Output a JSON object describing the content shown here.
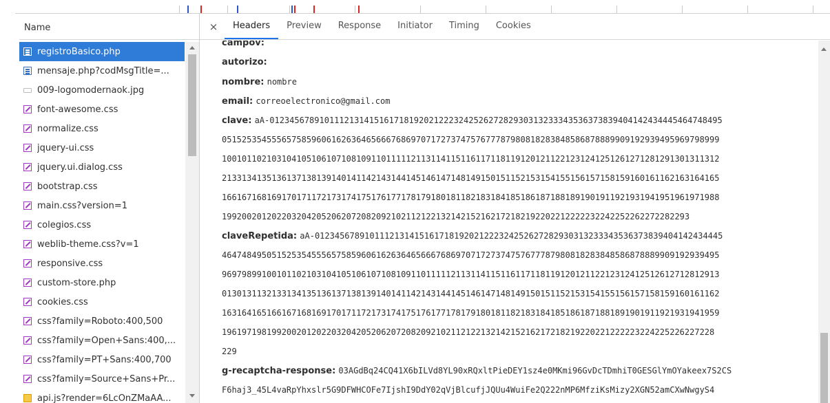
{
  "name_panel": {
    "header": "Name",
    "items": [
      {
        "label": "registroBasico.php",
        "icon": "document-icon",
        "selected": true
      },
      {
        "label": "mensaje.php?codMsgTitle=...",
        "icon": "document-icon"
      },
      {
        "label": "009-logomodernaok.jpg",
        "icon": "image-icon"
      },
      {
        "label": "font-awesome.css",
        "icon": "stylesheet-icon"
      },
      {
        "label": "normalize.css",
        "icon": "stylesheet-icon"
      },
      {
        "label": "jquery-ui.css",
        "icon": "stylesheet-icon"
      },
      {
        "label": "jquery.ui.dialog.css",
        "icon": "stylesheet-icon"
      },
      {
        "label": "bootstrap.css",
        "icon": "stylesheet-icon"
      },
      {
        "label": "main.css?version=1",
        "icon": "stylesheet-icon"
      },
      {
        "label": "colegios.css",
        "icon": "stylesheet-icon"
      },
      {
        "label": "weblib-theme.css?v=1",
        "icon": "stylesheet-icon"
      },
      {
        "label": "responsive.css",
        "icon": "stylesheet-icon"
      },
      {
        "label": "custom-store.php",
        "icon": "stylesheet-icon"
      },
      {
        "label": "cookies.css",
        "icon": "stylesheet-icon"
      },
      {
        "label": "css?family=Roboto:400,500",
        "icon": "stylesheet-icon"
      },
      {
        "label": "css?family=Open+Sans:400,...",
        "icon": "stylesheet-icon"
      },
      {
        "label": "css?family=PT+Sans:400,700",
        "icon": "stylesheet-icon"
      },
      {
        "label": "css?family=Source+Sans+Pr...",
        "icon": "stylesheet-icon"
      },
      {
        "label": "api.js?render=6LcOnZMaAA...",
        "icon": "script-icon"
      }
    ]
  },
  "tabs": {
    "close": "×",
    "items": [
      "Headers",
      "Preview",
      "Response",
      "Initiator",
      "Timing",
      "Cookies"
    ],
    "active": "Headers"
  },
  "form_data": {
    "campov_key": "campov:",
    "autorizo_key": "autorizo:",
    "nombre_key": "nombre:",
    "nombre_val": "nombre",
    "email_key": "email:",
    "email_val": "correoelectronico@gmail.com",
    "clave_key": "clave:",
    "clave_lines": [
      "aA-0123456789101112131415161718192021222324252627282930313233343536373839404142434445464748495",
      "0515253545556575859606162636465666768697071727374757677787980818283848586878889909192939495969798999",
      "1001011021031041051061071081091101111121131141151161171181191201211221231241251261271281291301311312",
      "2133134135136137138139140141142143144145146147148149150151152153154155156157158159160161162163164165",
      "1661671681691701711721731741751761771781791801811821831841851861871881891901911921931941951961971988",
      "1992002012022032042052062072082092102112122132142152162172182192202212222232242252262272282293"
    ],
    "clave_repetida_key": "claveRepetida:",
    "clave_repetida_lines": [
      "aA-0123456789101112131415161718192021222324252627282930313233343536373839404142434445",
      "4647484950515253545556575859606162636465666768697071727374757677787980818283848586878889909192939495",
      "9697989910010110210310410510610710810911011111211311411511611711811912012112212312412512612712812913",
      "0130131132133134135136137138139140141142143144145146147148149150151152153154155156157158159160161162",
      "1631641651661671681691701711721731741751761771781791801811821831841851861871881891901911921931941959",
      "196197198199200201202203204205206207208209210211212213214215216217218219220221222223224225226227228",
      "229"
    ],
    "recaptcha_key": "g-recaptcha-response:",
    "recaptcha_val": "03AGdBq24CQ41X6bILVd8YL90xRQxltPieDEY1sz4e0MKmi96GvDcTDmhiT0GESGlYmOYakeex7S2CS",
    "recaptcha_line2": "F6haj3_45L4vaRpYhxslr5G9DFWHCOFe7IjshI9DdY02qVjBlcufjJQUu4WuiFe2Q222nMP6MfziKsMizy2XGN52amCXwNwgyS4"
  },
  "colors": {
    "selected_row": "#2f7bd8",
    "active_tab_underline": "#1a73e8",
    "css_icon": "#a13ac2",
    "doc_icon": "#3b6fc2"
  }
}
